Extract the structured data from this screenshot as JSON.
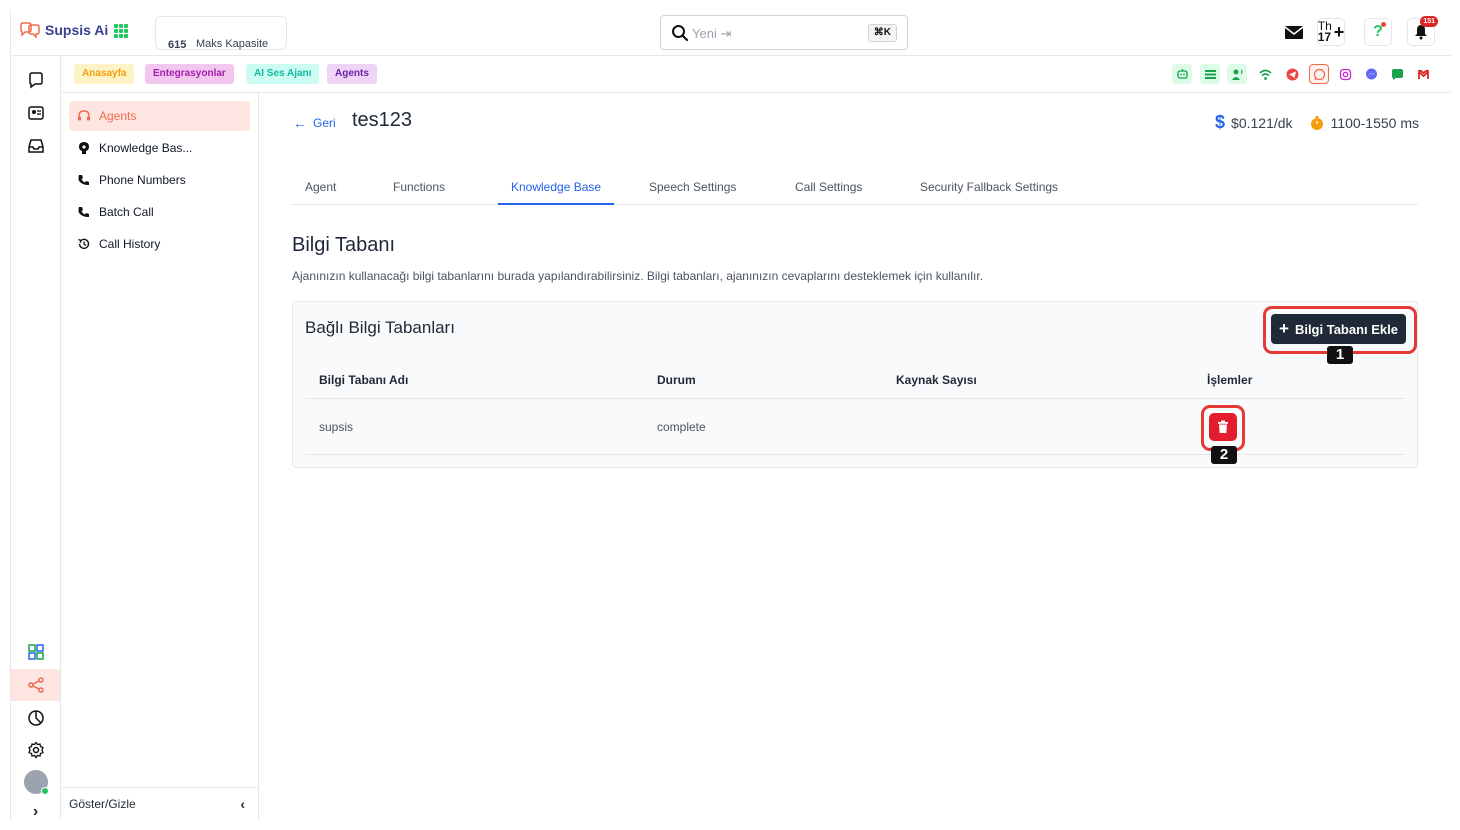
{
  "topbar": {
    "logo_text": "Supsis Ai",
    "capacity_value": "615",
    "capacity_label": "Maks Kapasite",
    "search_placeholder": "Yeni ⇥",
    "search_shortcut": "⌘K",
    "language_label": "Th",
    "language_sub": "17",
    "notification_count": "151"
  },
  "chips": [
    {
      "label": "Anasayfa",
      "bg": "#fef3c7",
      "color": "#f59e0b"
    },
    {
      "label": "Entegrasyonlar",
      "bg": "#f3c6ef",
      "color": "#a21caf"
    },
    {
      "label": "AI Ses Ajanı",
      "bg": "#ccfbf1",
      "color": "#14b8a6"
    },
    {
      "label": "Agents",
      "bg": "#f0d4f5",
      "color": "#6b21a8"
    }
  ],
  "social_icons": [
    "chatbot-icon",
    "list-icon",
    "voice-agent-icon",
    "wifi-icon",
    "telegram-icon",
    "whatsapp-icon",
    "instagram-icon",
    "messenger-icon",
    "sms-icon",
    "gmail-icon"
  ],
  "sidebar": {
    "items": [
      {
        "label": "Agents",
        "icon": "headset-icon"
      },
      {
        "label": "Knowledge Bas...",
        "icon": "brain-icon"
      },
      {
        "label": "Phone Numbers",
        "icon": "phone-icon"
      },
      {
        "label": "Batch Call",
        "icon": "phone-icon"
      },
      {
        "label": "Call History",
        "icon": "history-icon"
      }
    ],
    "footer_label": "Göster/Gizle"
  },
  "header": {
    "back_label": "Geri",
    "title": "tes123",
    "price": "$0.121/dk",
    "latency": "1100-1550 ms"
  },
  "tabs": [
    "Agent",
    "Functions",
    "Knowledge Base",
    "Speech Settings",
    "Call Settings",
    "Security Fallback Settings"
  ],
  "active_tab": "Knowledge Base",
  "section": {
    "title": "Bilgi Tabanı",
    "description": "Ajanınızın kullanacağı bilgi tabanlarını burada yapılandırabilirsiniz. Bilgi tabanları, ajanınızın cevaplarını desteklemek için kullanılır."
  },
  "card": {
    "title": "Bağlı Bilgi Tabanları",
    "add_button": "Bilgi Tabanı Ekle",
    "columns": [
      "Bilgi Tabanı Adı",
      "Durum",
      "Kaynak Sayısı",
      "İşlemler"
    ],
    "rows": [
      {
        "name": "supsis",
        "status": "complete",
        "sources": ""
      }
    ]
  },
  "annotations": [
    "1",
    "2"
  ],
  "colors": {
    "accent": "#2563eb",
    "brand": "#f06b4f",
    "danger": "#e11d2e",
    "highlight": "#e53935"
  }
}
